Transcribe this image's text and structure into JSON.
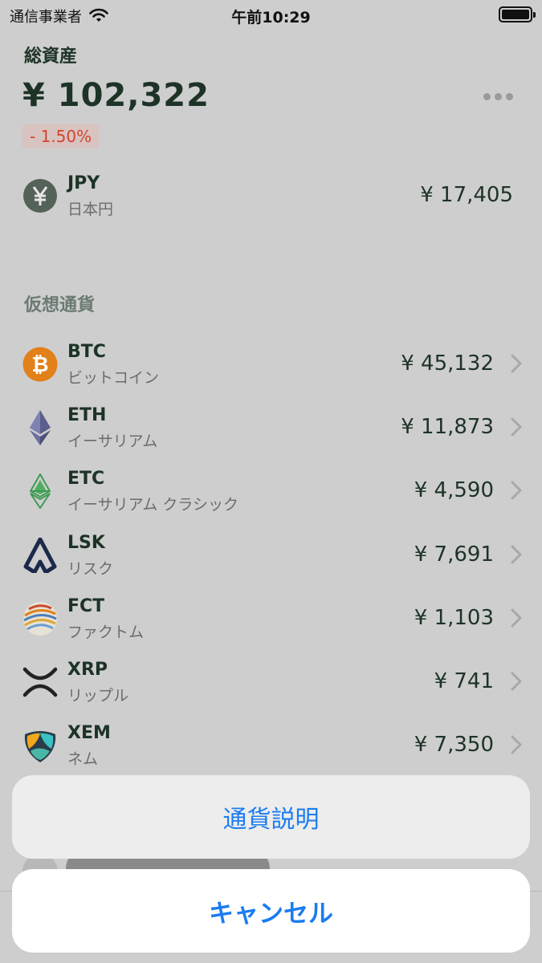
{
  "status_bar": {
    "carrier": "通信事業者",
    "time": "午前10:29"
  },
  "summary": {
    "label": "総資産",
    "total": "¥ 102,322",
    "change": "- 1.50%"
  },
  "fiat": {
    "code": "JPY",
    "name": "日本円",
    "amount": "¥ 17,405",
    "icon_glyph": "¥"
  },
  "crypto": {
    "section_label": "仮想通貨",
    "items": [
      {
        "code": "BTC",
        "name": "ビットコイン",
        "amount": "¥ 45,132",
        "icon": "bitcoin-icon"
      },
      {
        "code": "ETH",
        "name": "イーサリアム",
        "amount": "¥ 11,873",
        "icon": "ethereum-icon"
      },
      {
        "code": "ETC",
        "name": "イーサリアム クラシック",
        "amount": "¥ 4,590",
        "icon": "ethereum-classic-icon"
      },
      {
        "code": "LSK",
        "name": "リスク",
        "amount": "¥ 7,691",
        "icon": "lisk-icon"
      },
      {
        "code": "FCT",
        "name": "ファクトム",
        "amount": "¥ 1,103",
        "icon": "factom-icon"
      },
      {
        "code": "XRP",
        "name": "リップル",
        "amount": "¥ 741",
        "icon": "ripple-icon"
      },
      {
        "code": "XEM",
        "name": "ネム",
        "amount": "¥ 7,350",
        "icon": "nem-icon"
      }
    ]
  },
  "action_sheet": {
    "action_label": "通貨説明",
    "cancel_label": "キャンセル"
  },
  "colors": {
    "accent": "#1a7cf0",
    "negative": "#d2452e",
    "text_primary": "#1d3326",
    "bitcoin": "#e2801a"
  }
}
